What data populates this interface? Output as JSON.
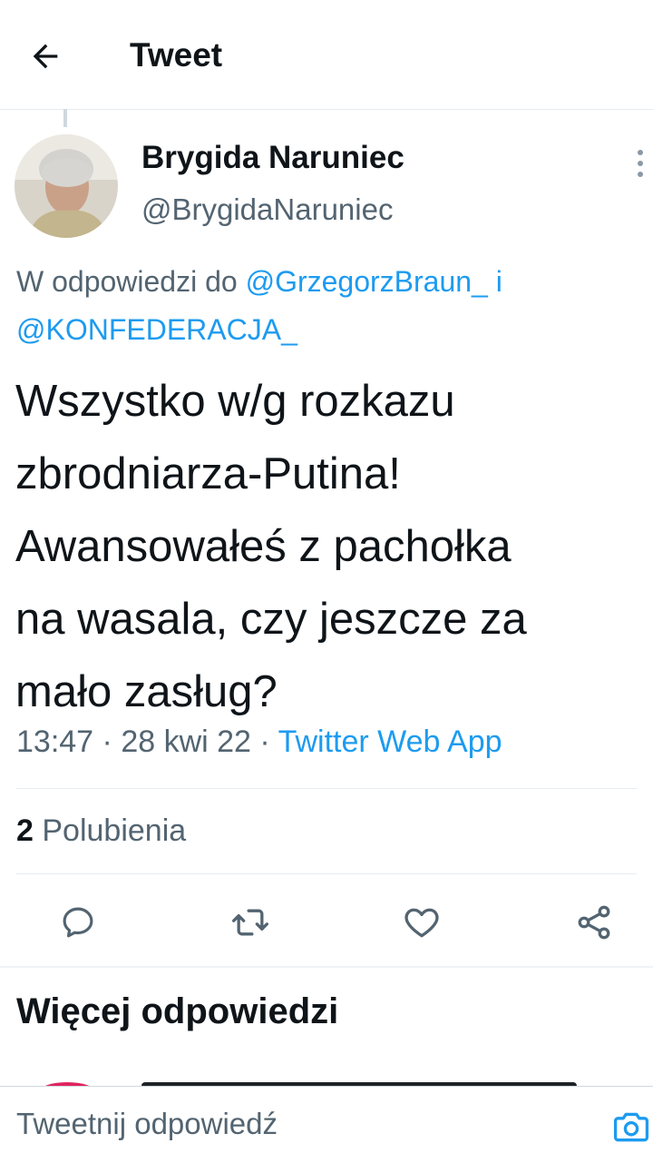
{
  "header": {
    "title": "Tweet",
    "back_icon": "arrow-left-icon"
  },
  "tweet": {
    "author_name": "Brygida Naruniec",
    "author_handle": "@BrygidaNaruniec",
    "reply_prefix": "W odpowiedzi do",
    "reply_mention_1": "@GrzegorzBraun_",
    "reply_conjunction": "i",
    "reply_mention_2": "@KONFEDERACJA_",
    "text": "Wszystko w/g rozkazu\nzbrodniarza-Putina!\nAwansowałeś z pachołka\nna wasala, czy jeszcze za\nmało zasług?",
    "time": "13:47",
    "dot": "·",
    "date": "28 kwi 22",
    "source": "Twitter Web App",
    "likes_count": "2",
    "likes_label": "Polubienia"
  },
  "actions": [
    "reply-icon",
    "retweet-icon",
    "like-icon",
    "share-icon"
  ],
  "section": {
    "more_replies_title": "Więcej odpowiedzi"
  },
  "composer": {
    "placeholder": "Tweetnij odpowiedź",
    "camera_icon": "camera-icon"
  },
  "colors": {
    "link": "#1d9bf0",
    "secondary": "#536471",
    "text": "#0f1419",
    "divider": "#e6ecf0"
  }
}
